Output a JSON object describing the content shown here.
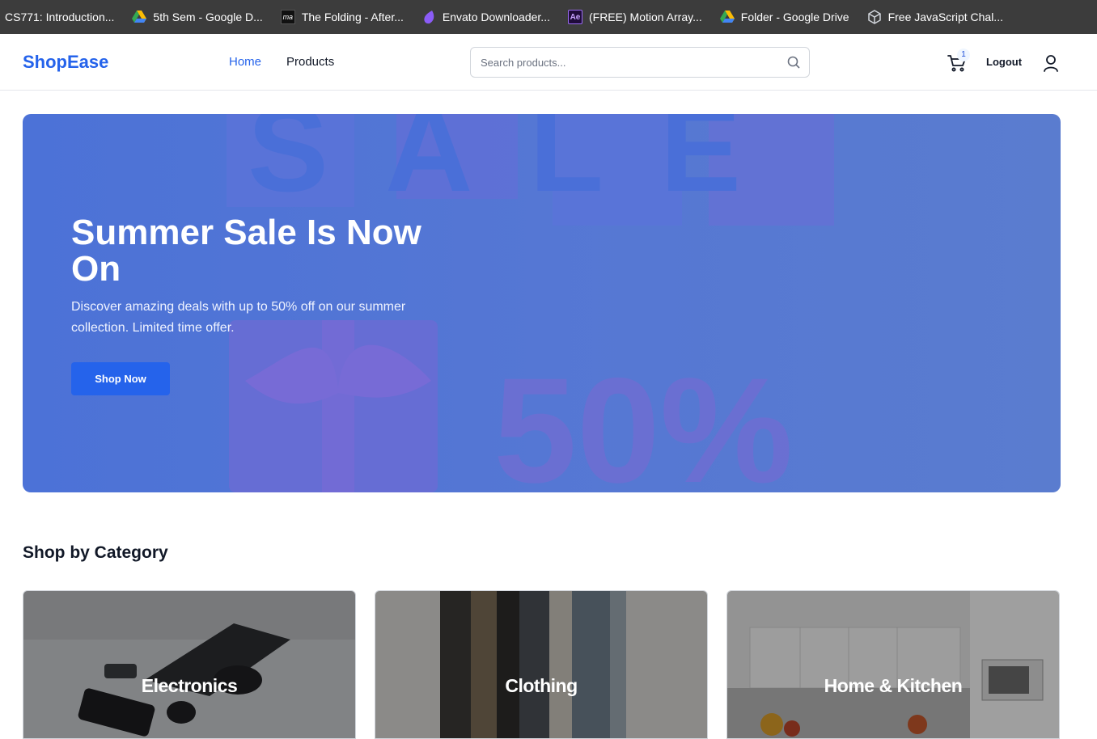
{
  "bookmarks": [
    {
      "label": "CS771: Introduction...",
      "icon": "none"
    },
    {
      "label": "5th Sem - Google D...",
      "icon": "google-drive-icon"
    },
    {
      "label": "The Folding - After...",
      "icon": "motion-array-icon",
      "badge": "ma"
    },
    {
      "label": "Envato Downloader...",
      "icon": "envato-icon"
    },
    {
      "label": "(FREE) Motion Array...",
      "icon": "after-effects-icon",
      "badge": "Ae"
    },
    {
      "label": "Folder - Google Drive",
      "icon": "google-drive-icon"
    },
    {
      "label": "Free JavaScript Chal...",
      "icon": "cube-icon"
    }
  ],
  "header": {
    "logo": "ShopEase",
    "nav": {
      "home": "Home",
      "products": "Products"
    },
    "search_placeholder": "Search products...",
    "cart_count": "1",
    "logout": "Logout"
  },
  "hero": {
    "title": "Summer Sale Is Now On",
    "subtitle": "Discover amazing deals with up to 50% off on our summer collection. Limited time offer.",
    "cta": "Shop Now",
    "bg_sale_word": "SALE",
    "bg_discount": "50%"
  },
  "categories": {
    "title": "Shop by Category",
    "items": [
      {
        "label": "Electronics"
      },
      {
        "label": "Clothing"
      },
      {
        "label": "Home & Kitchen"
      }
    ]
  },
  "colors": {
    "brand": "#2563eb",
    "bookmarks_bg": "#3c3c3c",
    "hero_overlay": "#4c72d7"
  }
}
